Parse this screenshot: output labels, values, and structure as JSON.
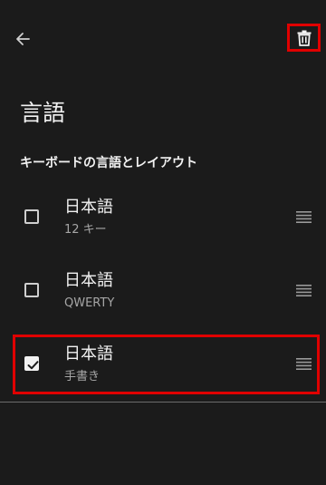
{
  "header": {
    "back_icon": "arrow-back-icon",
    "delete_icon": "trash-icon",
    "highlight_color": "#e00000"
  },
  "page": {
    "title": "言語"
  },
  "section": {
    "title": "キーボードの言語とレイアウト"
  },
  "languages": [
    {
      "name": "日本語",
      "layout": "12 キー",
      "checked": false
    },
    {
      "name": "日本語",
      "layout": "QWERTY",
      "checked": false
    },
    {
      "name": "日本語",
      "layout": "手書き",
      "checked": true
    }
  ]
}
